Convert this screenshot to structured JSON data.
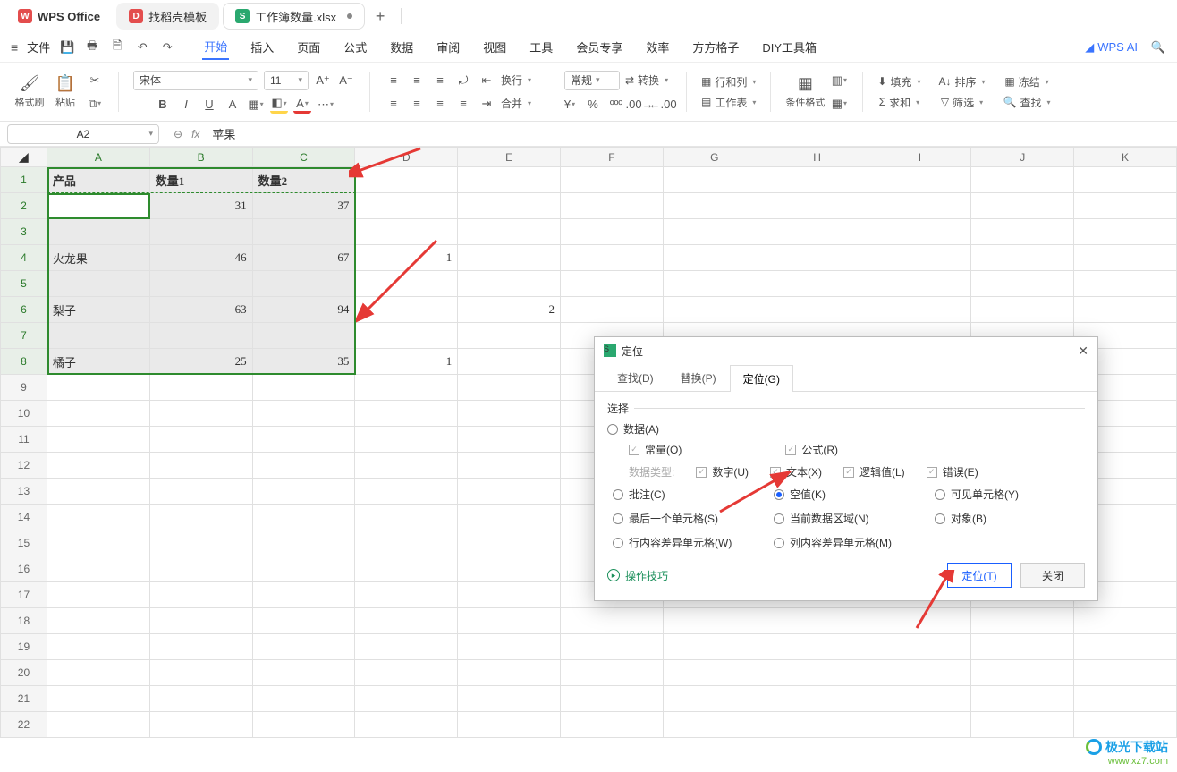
{
  "titlebar": {
    "app_name": "WPS Office",
    "tabs": [
      {
        "label": "找稻壳模板",
        "icon_bg": "#e34d4d",
        "icon_text": "D"
      },
      {
        "label": "工作簿数量.xlsx",
        "icon_bg": "#2aa86f",
        "icon_text": "S",
        "active": true,
        "dirty": true
      }
    ],
    "add": "+"
  },
  "menubar": {
    "file": "文件",
    "items": [
      "开始",
      "插入",
      "页面",
      "公式",
      "数据",
      "审阅",
      "视图",
      "工具",
      "会员专享",
      "效率",
      "方方格子",
      "DIY工具箱"
    ],
    "active_index": 0,
    "wps_ai": "WPS AI"
  },
  "ribbon": {
    "format_painter": "格式刷",
    "paste": "粘贴",
    "font_name": "宋体",
    "font_size": "11",
    "number_format": "常规",
    "convert": "转换",
    "wrap": "换行",
    "merge": "合并",
    "rowcol": "行和列",
    "worksheet": "工作表",
    "cond_format": "条件格式",
    "fill": "填充",
    "sum": "求和",
    "sort": "排序",
    "freeze": "冻结",
    "filter": "筛选",
    "find": "查找"
  },
  "formula_bar": {
    "name_box": "A2",
    "fx": "fx",
    "value": "苹果"
  },
  "grid": {
    "columns": [
      "A",
      "B",
      "C",
      "D",
      "E",
      "F",
      "G",
      "H",
      "I",
      "J",
      "K"
    ],
    "row_count": 22,
    "selected_cols": [
      "A",
      "B",
      "C"
    ],
    "selected_rows": [
      1,
      2,
      3,
      4,
      5,
      6,
      7,
      8
    ],
    "header_row": {
      "A": "产品",
      "B": "数量1",
      "C": "数量2"
    },
    "data": {
      "2": {
        "A": "苹果",
        "B": "31",
        "C": "37"
      },
      "4": {
        "A": "火龙果",
        "B": "46",
        "C": "67",
        "D": "1"
      },
      "6": {
        "A": "梨子",
        "B": "63",
        "C": "94",
        "E": "2"
      },
      "8": {
        "A": "橘子",
        "B": "25",
        "C": "35",
        "D": "1"
      }
    }
  },
  "dialog": {
    "title": "定位",
    "tabs": [
      "查找(D)",
      "替换(P)",
      "定位(G)"
    ],
    "active_tab": 2,
    "section": "选择",
    "opts": {
      "data": "数据(A)",
      "const": "常量(O)",
      "formula": "公式(R)",
      "dtype_label": "数据类型:",
      "num": "数字(U)",
      "text": "文本(X)",
      "logic": "逻辑值(L)",
      "error": "错误(E)",
      "comment": "批注(C)",
      "blank": "空值(K)",
      "visible": "可见单元格(Y)",
      "last": "最后一个单元格(S)",
      "region": "当前数据区域(N)",
      "object": "对象(B)",
      "rowdiff": "行内容差异单元格(W)",
      "coldiff": "列内容差异单元格(M)"
    },
    "selected": "blank",
    "tips": "操作技巧",
    "btn_ok": "定位(T)",
    "btn_close": "关闭"
  },
  "watermark": {
    "line1": "极光下载站",
    "line2": "www.xz7.com"
  }
}
